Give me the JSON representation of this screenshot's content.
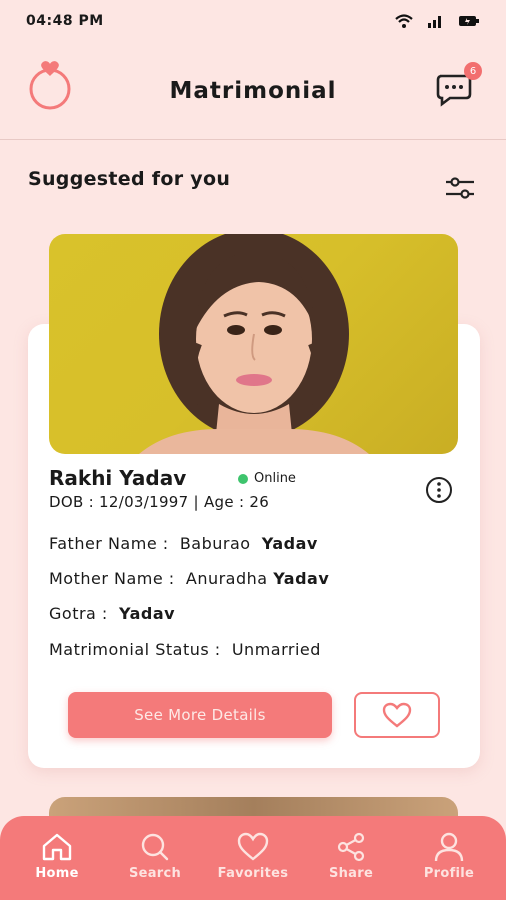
{
  "status": {
    "time": "04:48 PM"
  },
  "header": {
    "title": "Matrimonial",
    "chat_badge": "6",
    "logo_icon": "ring-icon",
    "chat_icon": "chat-icon"
  },
  "section": {
    "title": "Suggested for you",
    "filter_icon": "filter-icon"
  },
  "profile": {
    "name": "Rakhi Yadav",
    "status": "Online",
    "dob_line": "DOB : 12/03/1997  |  Age : 26",
    "father_label": "Father Name :",
    "father_first": "Baburao",
    "father_last": "Yadav",
    "mother_label": "Mother Name :",
    "mother_first": "Anuradha",
    "mother_last": "Yadav",
    "gotra_label": "Gotra :",
    "gotra_value": "Yadav",
    "marital_label": "Matrimonial Status :",
    "marital_value": "Unmarried",
    "see_more_label": "See More Details"
  },
  "nav": {
    "items": [
      {
        "label": "Home",
        "icon": "home-icon"
      },
      {
        "label": "Search",
        "icon": "search-icon"
      },
      {
        "label": "Favorites",
        "icon": "heart-icon"
      },
      {
        "label": "Share",
        "icon": "share-icon"
      },
      {
        "label": "Profile",
        "icon": "person-icon"
      }
    ]
  },
  "colors": {
    "accent": "#f47a7a",
    "background": "#fde6e3",
    "online": "#3ec46d"
  }
}
